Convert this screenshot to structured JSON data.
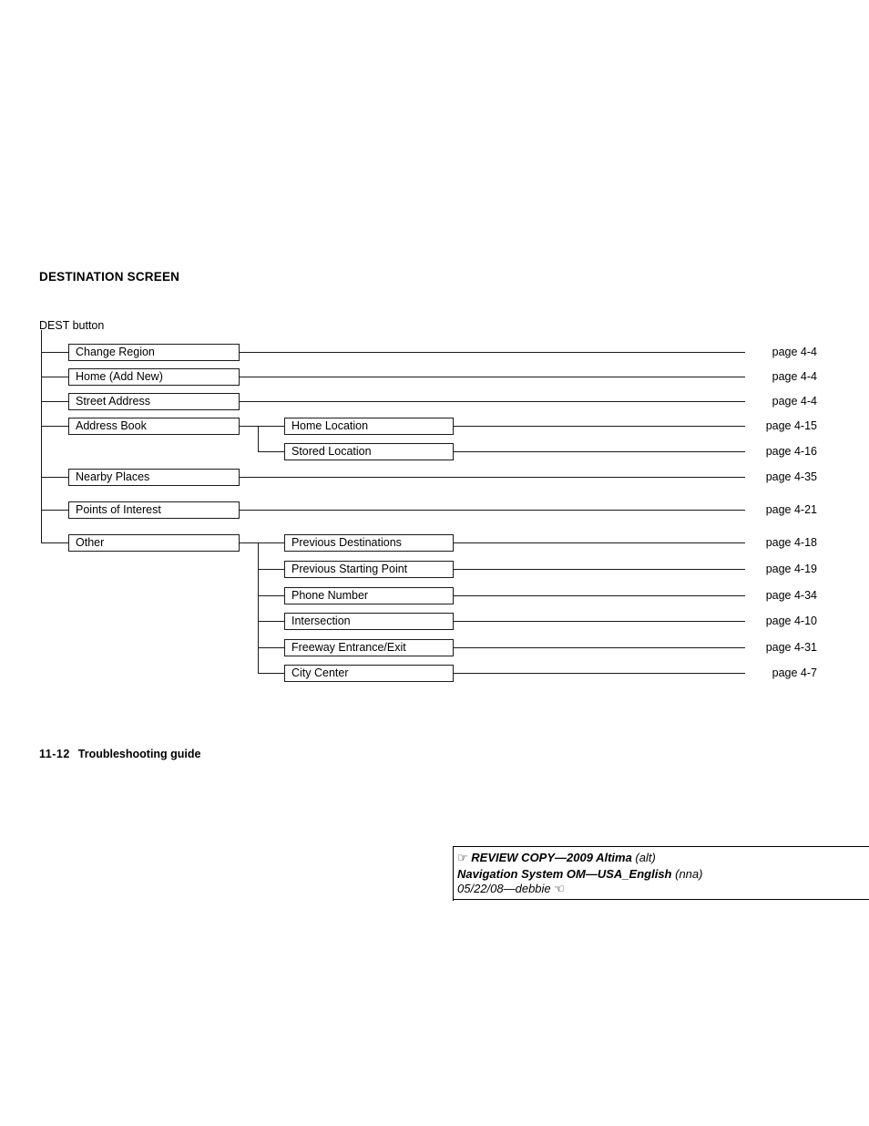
{
  "document": {
    "section_title": "DESTINATION SCREEN",
    "root_label": "DEST button"
  },
  "chart_data": {
    "type": "diagram",
    "title": "DESTINATION SCREEN",
    "root": "DEST button",
    "nodes": [
      {
        "label": "Change Region",
        "level": 1,
        "page": "page 4-4"
      },
      {
        "label": "Home (Add New)",
        "level": 1,
        "page": "page 4-4"
      },
      {
        "label": "Street Address",
        "level": 1,
        "page": "page 4-4"
      },
      {
        "label": "Address Book",
        "level": 1,
        "page": ""
      },
      {
        "label": "Home Location",
        "level": 2,
        "page": "page 4-15"
      },
      {
        "label": "Stored Location",
        "level": 2,
        "page": "page 4-16"
      },
      {
        "label": "Nearby Places",
        "level": 1,
        "page": "page 4-35"
      },
      {
        "label": "Points of Interest",
        "level": 1,
        "page": "page 4-21"
      },
      {
        "label": "Other",
        "level": 1,
        "page": ""
      },
      {
        "label": "Previous Destinations",
        "level": 2,
        "page": "page 4-18"
      },
      {
        "label": "Previous Starting Point",
        "level": 2,
        "page": "page 4-19"
      },
      {
        "label": "Phone Number",
        "level": 2,
        "page": "page 4-34"
      },
      {
        "label": "Intersection",
        "level": 2,
        "page": "page 4-10"
      },
      {
        "label": "Freeway Entrance/Exit",
        "level": 2,
        "page": "page 4-31"
      },
      {
        "label": "City Center",
        "level": 2,
        "page": "page 4-7"
      }
    ]
  },
  "boxes": {
    "change_region": "Change Region",
    "home_add_new": "Home (Add New)",
    "street_address": "Street Address",
    "address_book": "Address Book",
    "home_location": "Home Location",
    "stored_location": "Stored Location",
    "nearby_places": "Nearby Places",
    "points_of_interest": "Points of Interest",
    "other": "Other",
    "previous_destinations": "Previous Destinations",
    "previous_starting_point": "Previous Starting Point",
    "phone_number": "Phone Number",
    "intersection": "Intersection",
    "freeway_entrance_exit": "Freeway Entrance/Exit",
    "city_center": "City Center"
  },
  "page_refs": {
    "change_region": "page 4-4",
    "home_add_new": "page 4-4",
    "street_address": "page 4-4",
    "home_location": "page 4-15",
    "stored_location": "page 4-16",
    "nearby_places": "page 4-35",
    "points_of_interest": "page 4-21",
    "previous_destinations": "page 4-18",
    "previous_starting_point": "page 4-19",
    "phone_number": "page 4-34",
    "intersection": "page 4-10",
    "freeway_entrance_exit": "page 4-31",
    "city_center": "page 4-7"
  },
  "footer": {
    "folio_number": "11-12",
    "folio_text": "Troubleshooting guide"
  },
  "review_stamp": {
    "hand_right_icon": "☞",
    "line1_bold": "REVIEW COPY—2009 Altima",
    "line1_paren": "(alt)",
    "line2_bold": "Navigation System OM—USA_English",
    "line2_paren": "(nna)",
    "line3": "05/22/08—debbie",
    "hand_left_icon": "☜"
  },
  "colors": {
    "ink": "#1a1a1a",
    "paper": "#ffffff"
  }
}
